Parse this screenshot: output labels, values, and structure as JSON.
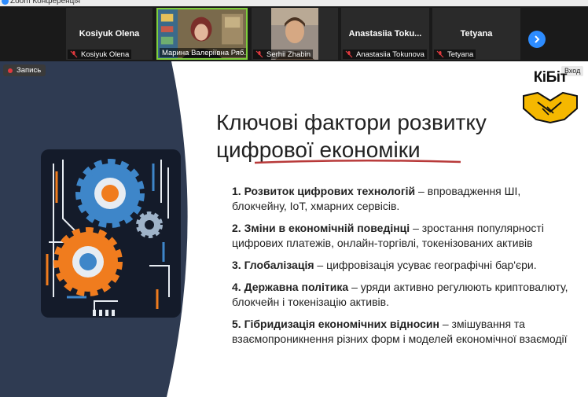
{
  "window": {
    "title": "Zoom Конференція"
  },
  "participants": [
    {
      "display_name": "Kosiyuk Olena",
      "label": "Kosiyuk Olena",
      "video": false,
      "muted": true
    },
    {
      "display_name": "",
      "label": "Марина Валеріївна Ряб...",
      "video": true,
      "muted": false,
      "active": true
    },
    {
      "display_name": "",
      "label": "Serhii Zhabin",
      "video": true,
      "muted": true
    },
    {
      "display_name": "Anastasiia  Toku...",
      "label": "Anastasiia Tokunova",
      "video": false,
      "muted": true
    },
    {
      "display_name": "Tetyana",
      "label": "Tetyana",
      "video": false,
      "muted": true
    }
  ],
  "recording": {
    "label": "Запись"
  },
  "entry_tag": "Вход",
  "logo": {
    "text": "КіБіт"
  },
  "slide": {
    "title_line1": "Ключові фактори розвитку",
    "title_line2": "цифрової економіки",
    "points": [
      {
        "heading": "1. Розвиток цифрових технологій",
        "text": " – впровадження ШІ, блокчейну, IoT, хмарних сервісів."
      },
      {
        "heading": "2. Зміни в економічній поведінці",
        "text": " – зростання популярності цифрових платежів, онлайн-торгівлі, токенізованих активів"
      },
      {
        "heading": "3. Глобалізація",
        "text": " – цифровізація усуває географічні бар'єри."
      },
      {
        "heading": "4. Державна політика",
        "text": " – уряди активно регулюють криптовалюту, блокчейн і токенізацію активів."
      },
      {
        "heading": "5. Гібридизація економічних відносин",
        "text": " – змішування та взаємопроникнення різних форм і моделей економічної взаємодії"
      }
    ]
  },
  "colors": {
    "accent_blue": "#2d8cff",
    "slide_navy": "#2f3b52",
    "gear_orange": "#f07c1e",
    "gear_blue": "#3e86c9",
    "logo_yellow": "#f5b800"
  }
}
